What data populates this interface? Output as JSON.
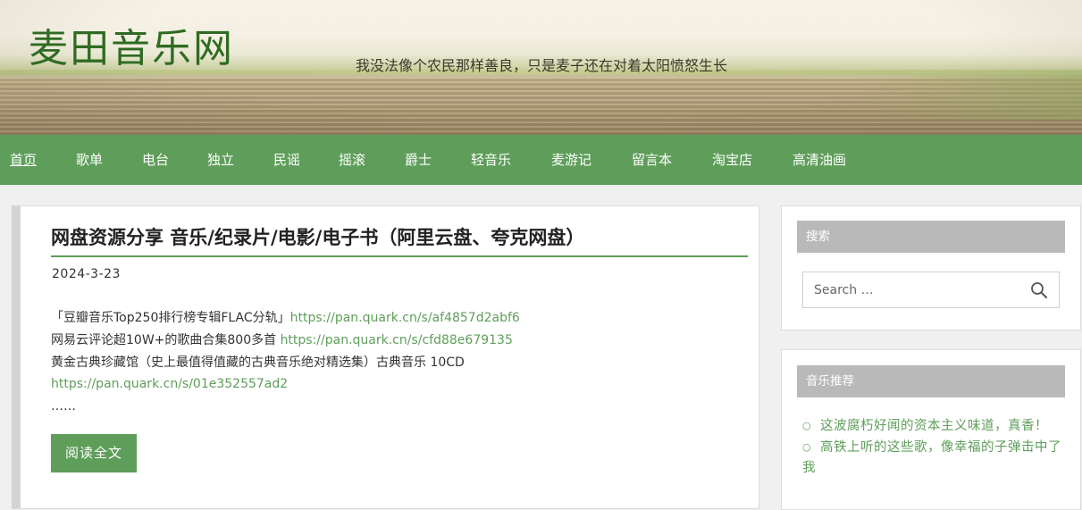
{
  "header": {
    "site_title": "麦田音乐网",
    "tagline": "我没法像个农民那样善良，只是麦子还在对着太阳愤怒生长"
  },
  "nav": {
    "items": [
      {
        "label": "首页",
        "active": true
      },
      {
        "label": "歌单"
      },
      {
        "label": "电台"
      },
      {
        "label": "独立"
      },
      {
        "label": "民谣"
      },
      {
        "label": "摇滚"
      },
      {
        "label": "爵士"
      },
      {
        "label": "轻音乐"
      },
      {
        "label": "麦游记"
      },
      {
        "label": "留言本"
      },
      {
        "label": "淘宝店"
      },
      {
        "label": "高清油画"
      }
    ]
  },
  "article": {
    "title": "网盘资源分享 音乐/纪录片/电影/电子书（阿里云盘、夸克网盘）",
    "date": "2024-3-23",
    "lines": [
      {
        "text": "「豆瓣音乐Top250排行榜专辑FLAC分轨」",
        "link": "https://pan.quark.cn/s/af4857d2abf6"
      },
      {
        "text": "网易云评论超10W+的歌曲合集800多首 ",
        "link": "https://pan.quark.cn/s/cfd88e679135"
      },
      {
        "text": "黄金古典珍藏馆（史上最值得值藏的古典音乐绝对精选集）古典音乐 10CD",
        "link": "https://pan.quark.cn/s/01e352557ad2"
      }
    ],
    "ellipsis": "……",
    "read_more": "阅读全文"
  },
  "sidebar": {
    "search": {
      "title": "搜索",
      "placeholder": "Search …"
    },
    "recommend": {
      "title": "音乐推荐",
      "items": [
        {
          "label": "这波腐朽好闻的资本主义味道，真香！"
        },
        {
          "label": "高铁上听的这些歌，像幸福的子弹击中了我"
        }
      ]
    }
  },
  "colors": {
    "accent": "#5e9e5a",
    "site_title": "#2f6b22",
    "widget_title_bg": "#b9b9b9"
  }
}
